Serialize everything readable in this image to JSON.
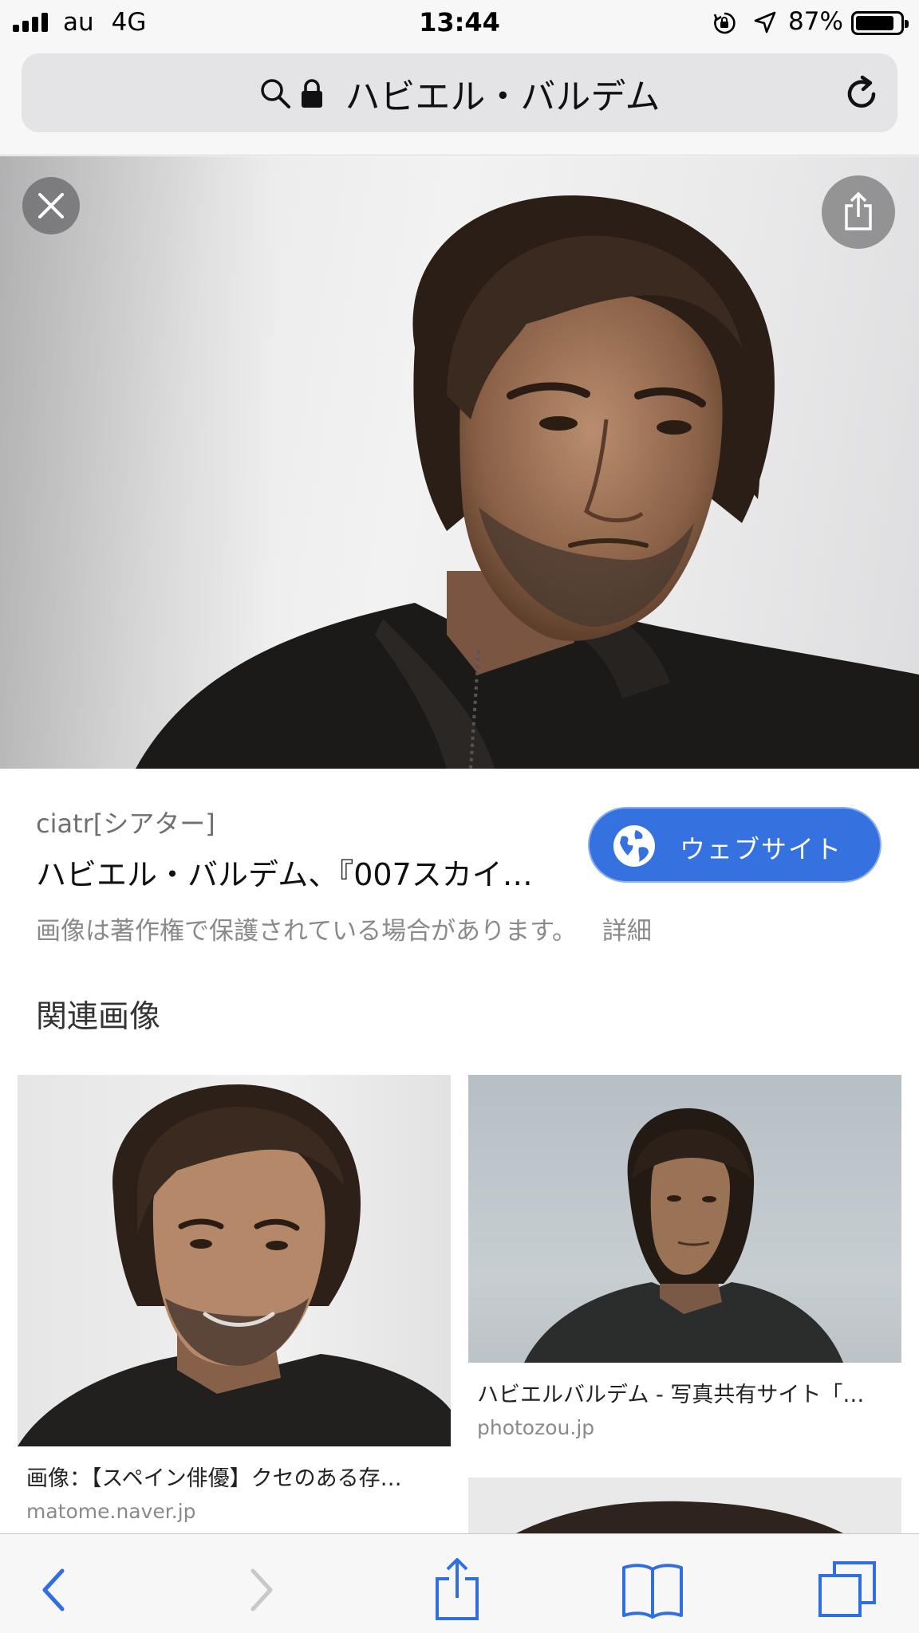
{
  "status_bar": {
    "carrier": "au",
    "network": "4G",
    "time": "13:44",
    "battery_percent": "87%",
    "battery_level": 0.87,
    "icons": [
      "signal-icon",
      "rotation-lock-icon",
      "location-arrow-icon",
      "battery-icon"
    ]
  },
  "address_bar": {
    "query": "ハビエル・バルデム",
    "icons": [
      "search-icon",
      "lock-icon",
      "reload-icon"
    ]
  },
  "hero": {
    "overlay_buttons": [
      "close-icon",
      "share-icon"
    ]
  },
  "result": {
    "source": "ciatr[シアター]",
    "title": "ハビエル・バルデム、『007スカイ…",
    "website_button": "ウェブサイト",
    "copyright_notice": "画像は著作権で保護されている場合があります。",
    "details_link": "詳細"
  },
  "related": {
    "heading": "関連画像",
    "items": [
      {
        "caption": "画像：【スペイン俳優】クセのある存…",
        "domain": "matome.naver.jp"
      },
      {
        "caption": "ハビエルバルデム - 写真共有サイト「…",
        "domain": "photozou.jp"
      },
      {
        "caption": "",
        "domain": ""
      }
    ]
  },
  "toolbar": {
    "buttons": [
      "back-icon",
      "forward-icon",
      "share-icon",
      "bookmarks-icon",
      "tabs-icon"
    ]
  },
  "colors": {
    "accent_blue": "#3572df",
    "toolbar_bg": "#f7f7f7",
    "address_bg": "#e4e4e6",
    "secondary_text": "#8a8a8a"
  }
}
